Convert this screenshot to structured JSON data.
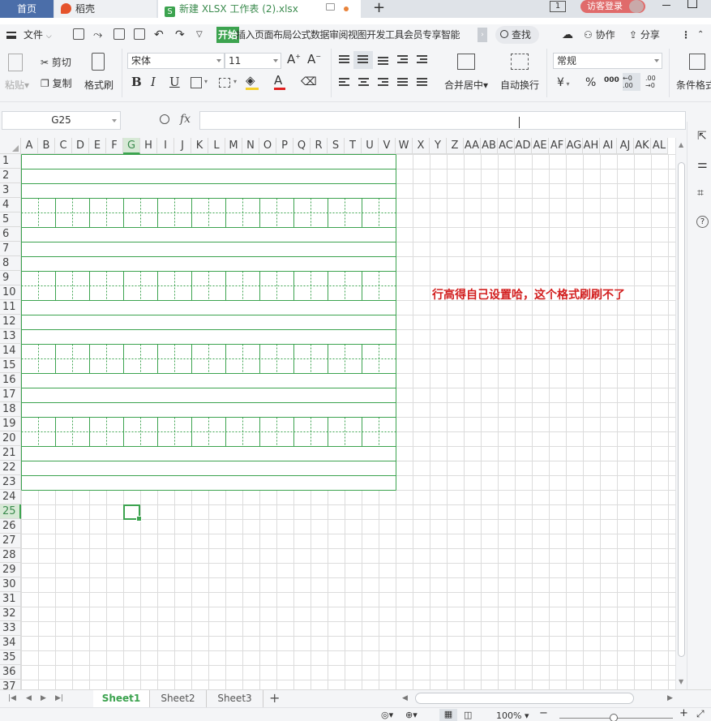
{
  "tabs": {
    "home": "首页",
    "daoke": "稻壳",
    "doc_title": "新建 XLSX 工作表 (2).xlsx",
    "doc_icon_letter": "S"
  },
  "title_right": {
    "badge": "1",
    "login": "访客登录"
  },
  "menu": {
    "file": "文件",
    "active_tab": "开始",
    "tabs_text": "插入页面布局公式数据审阅视图开发工具会员专享智能",
    "more": "›",
    "search": "查找",
    "collab": "协作",
    "share": "分享"
  },
  "ribbon": {
    "paste": "粘贴",
    "cut": "剪切",
    "copy": "复制",
    "format_painter": "格式刷",
    "font_name": "宋体",
    "font_size": "11",
    "merge_center": "合并居中",
    "wrap_text": "自动换行",
    "number_format": "常规",
    "currency": "¥",
    "percent": "%",
    "thousands": "000",
    "cond_format": "条件格式"
  },
  "formula_bar": {
    "cell_ref": "G25",
    "fx": "fx",
    "content": ""
  },
  "grid": {
    "columns": [
      "A",
      "B",
      "C",
      "D",
      "E",
      "F",
      "G",
      "H",
      "I",
      "J",
      "K",
      "L",
      "M",
      "N",
      "O",
      "P",
      "Q",
      "R",
      "S",
      "T",
      "U",
      "V",
      "W",
      "X",
      "Y",
      "Z",
      "AA",
      "AB",
      "AC",
      "AD",
      "AE",
      "AF",
      "AG",
      "AH",
      "AI",
      "AJ",
      "AK",
      "AL"
    ],
    "rows": [
      "1",
      "2",
      "3",
      "4",
      "5",
      "6",
      "7",
      "8",
      "9",
      "10",
      "11",
      "12",
      "13",
      "14",
      "15",
      "16",
      "17",
      "18",
      "19",
      "20",
      "21",
      "22",
      "23",
      "24",
      "25",
      "26",
      "27",
      "28",
      "29",
      "30",
      "31",
      "32",
      "33",
      "34",
      "35",
      "36",
      "37"
    ],
    "selected_column": "G",
    "selected_row": "25",
    "selected_cell": "G25"
  },
  "annotation": "行高得自己设置哈，这个格式刷刷不了",
  "sheets": [
    "Sheet1",
    "Sheet2",
    "Sheet3"
  ],
  "active_sheet": "Sheet1",
  "status": {
    "zoom": "100%"
  },
  "colors": {
    "accent_green": "#3ca34f",
    "annotation_red": "#d21e1e",
    "home_tab_blue": "#4b6ea9"
  }
}
